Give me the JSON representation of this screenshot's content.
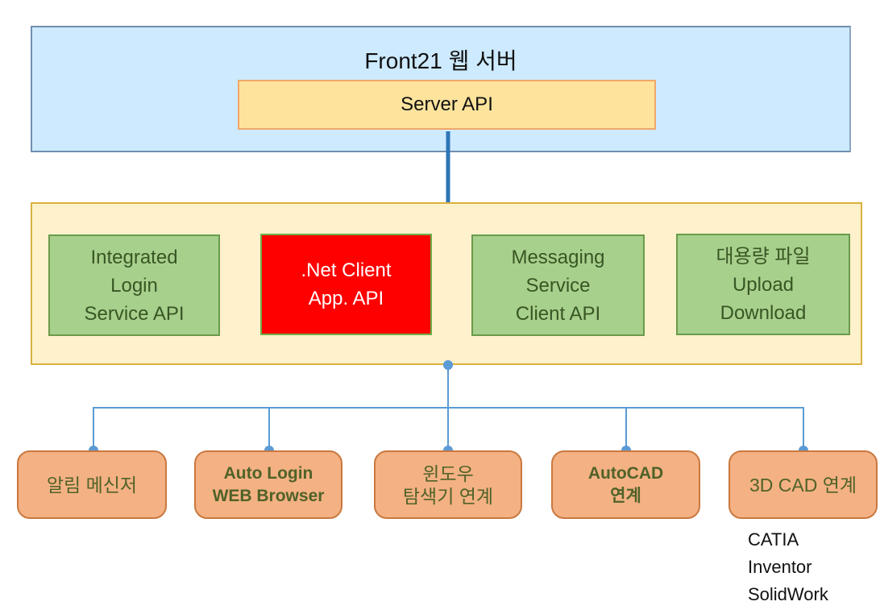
{
  "server": {
    "title": "Front21 웹 서버",
    "api_label": "Server API"
  },
  "client_apis": [
    {
      "lines": [
        "Integrated",
        "Login",
        "Service API"
      ],
      "color": "#a8d08d"
    },
    {
      "lines": [
        ".Net Client",
        "App. API"
      ],
      "color": "#ff0000"
    },
    {
      "lines": [
        "Messaging",
        "Service",
        "Client API"
      ],
      "color": "#a8d08d"
    },
    {
      "lines": [
        "대용량 파일",
        "Upload",
        "Download"
      ],
      "color": "#a8d08d"
    }
  ],
  "modules": [
    {
      "lines": [
        "알림 메신저"
      ]
    },
    {
      "lines": [
        "Auto Login",
        "WEB Browser"
      ]
    },
    {
      "lines": [
        "윈도우",
        "탐색기 연계"
      ]
    },
    {
      "lines": [
        "AutoCAD",
        "연계"
      ]
    },
    {
      "lines": [
        "3D CAD 연계"
      ]
    }
  ],
  "cad_products": [
    "CATIA",
    "Inventor",
    "SolidWork"
  ],
  "colors": {
    "server_bg": "#cdeafe",
    "server_api_bg": "#fde39c",
    "client_bg": "#fff1cc",
    "api_green": "#a8d08d",
    "api_highlight": "#ff0000",
    "module_orange": "#f4b183",
    "connector_blue": "#5b9bd5",
    "trunk_blue": "#2e75b6"
  }
}
